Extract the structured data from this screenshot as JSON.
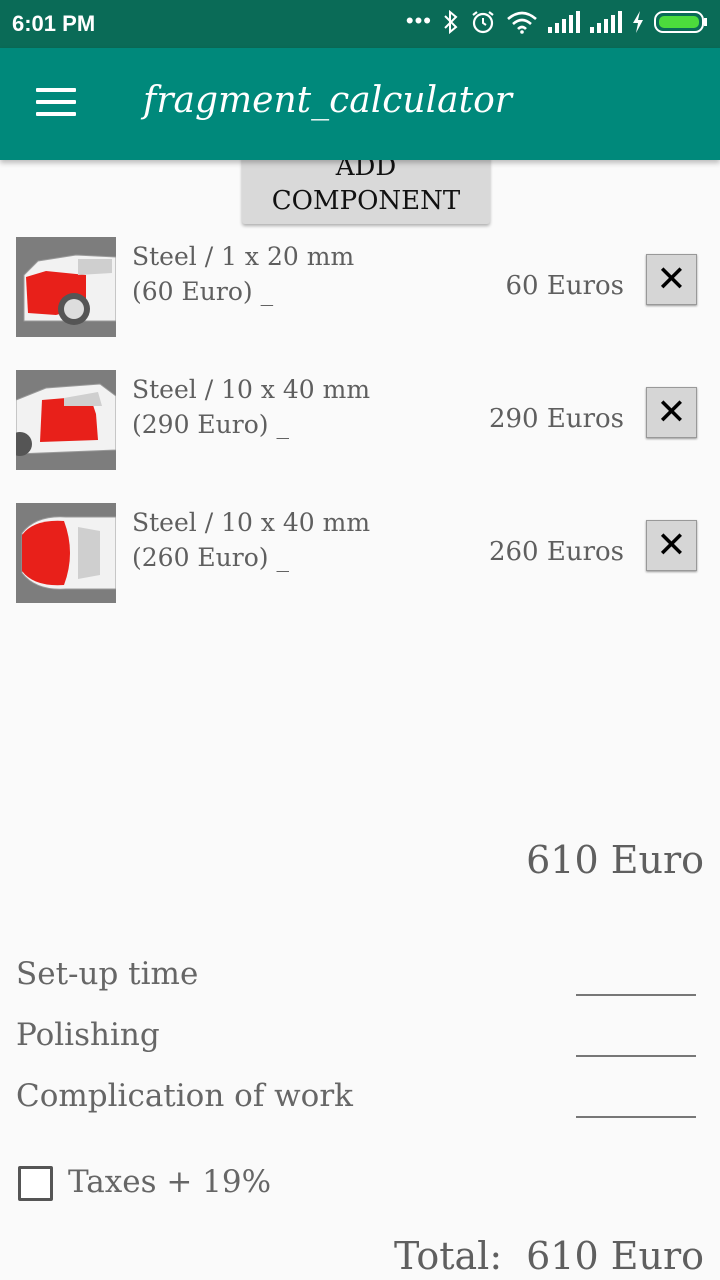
{
  "status_bar": {
    "time": "6:01 PM"
  },
  "app_bar": {
    "title": "fragment_calculator"
  },
  "add_button": {
    "line1": "ADD",
    "line2": "COMPONENT"
  },
  "components": [
    {
      "desc_line1": "Steel / 1 x 20 mm",
      "desc_line2": "(60 Euro) _",
      "price": "60 Euros",
      "delete_label": "✕",
      "part": "rear-quarter"
    },
    {
      "desc_line1": "Steel / 10 x 40 mm",
      "desc_line2": "(290 Euro) _",
      "price": "290 Euros",
      "delete_label": "✕",
      "part": "front-door"
    },
    {
      "desc_line1": "Steel / 10 x 40 mm",
      "desc_line2": "(260 Euro) _",
      "price": "260 Euros",
      "delete_label": "✕",
      "part": "hood"
    }
  ],
  "subtotal": "610 Euro",
  "extras": [
    {
      "label": "Set-up time",
      "value": ""
    },
    {
      "label": "Polishing",
      "value": ""
    },
    {
      "label": "Complication of work",
      "value": ""
    }
  ],
  "taxes": {
    "label": "Taxes + 19%",
    "checked": false
  },
  "total": {
    "label": "Total:",
    "value": "610 Euro"
  },
  "colors": {
    "status_bar": "#0a6b57",
    "app_bar": "#00897b",
    "highlight": "#e8201a"
  }
}
